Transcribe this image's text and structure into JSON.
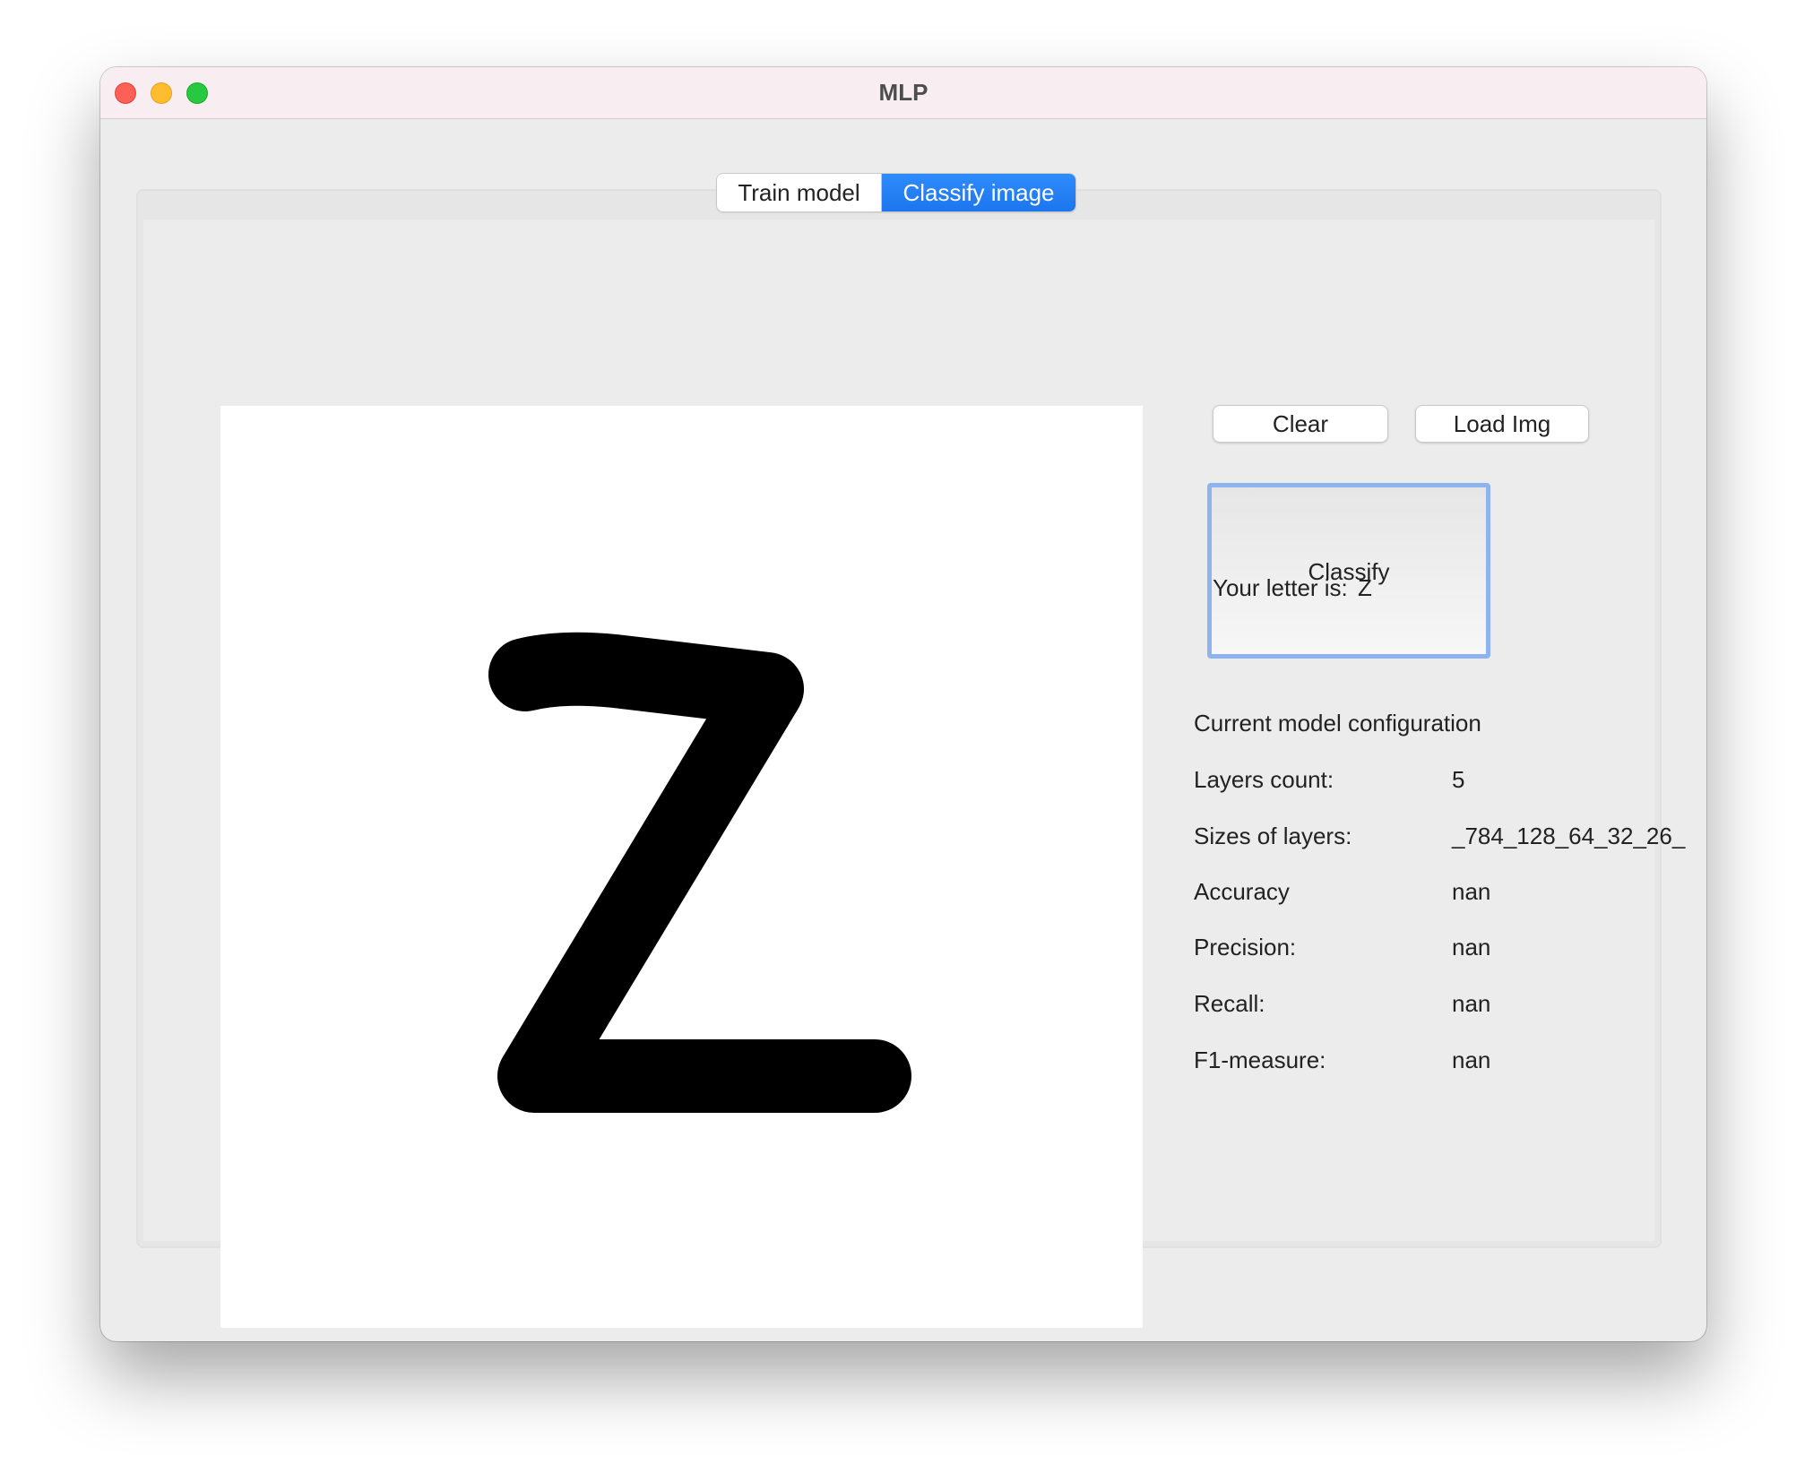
{
  "window": {
    "title": "MLP"
  },
  "tabs": [
    {
      "label": "Train model",
      "selected": false
    },
    {
      "label": "Classify image",
      "selected": true
    }
  ],
  "buttons": {
    "clear": "Clear",
    "load_img": "Load Img",
    "classify": "Classify"
  },
  "result": {
    "label": "Your letter is:",
    "value": "Z"
  },
  "model_config": {
    "heading": "Current model configuration",
    "rows": [
      {
        "label": "Layers count:",
        "value": "5"
      },
      {
        "label": "Sizes of layers:",
        "value": "_784_128_64_32_26_"
      },
      {
        "label": "Accuracy",
        "value": "nan"
      },
      {
        "label": "Precision:",
        "value": "nan"
      },
      {
        "label": "Recall:",
        "value": "nan"
      },
      {
        "label": "F1-measure:",
        "value": "nan"
      }
    ]
  },
  "colors": {
    "accent": "#1c75ee",
    "focus_ring": "#8db4ef",
    "drawing_stroke": "#000000",
    "canvas_bg": "#ffffff"
  }
}
